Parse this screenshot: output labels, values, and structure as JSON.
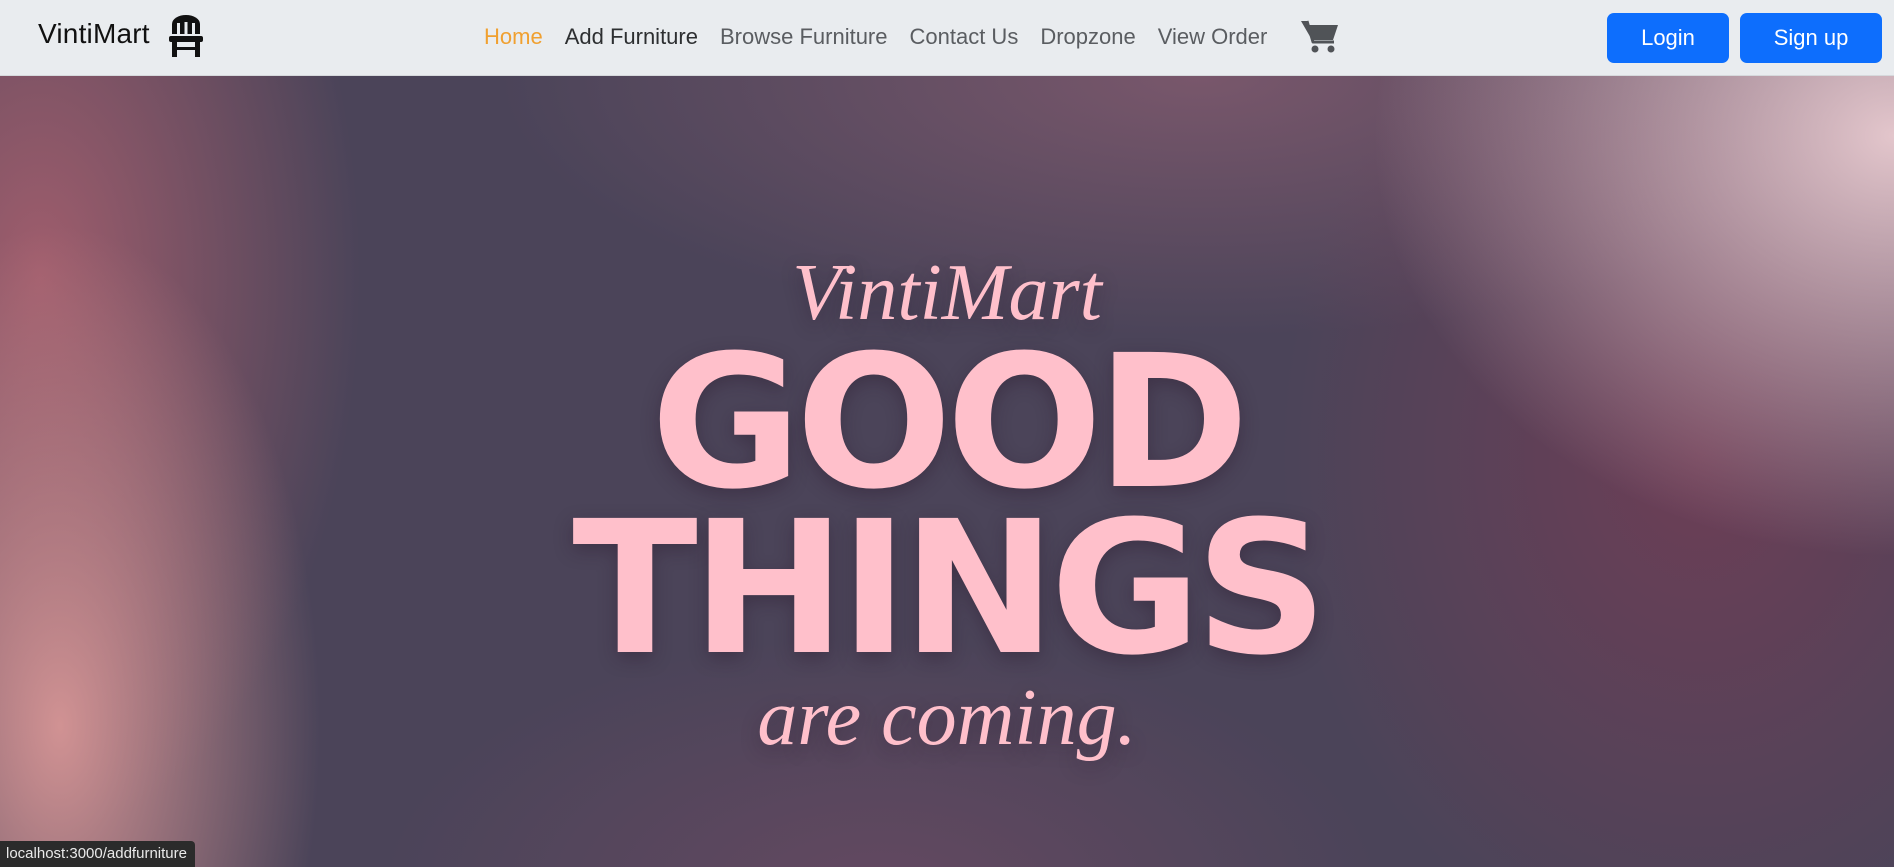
{
  "navbar": {
    "brand": "VintiMart",
    "brand_icon": "chair-icon",
    "links": [
      {
        "label": "Home",
        "state": "active"
      },
      {
        "label": "Add Furniture",
        "state": "hover"
      },
      {
        "label": "Browse Furniture",
        "state": "default"
      },
      {
        "label": "Contact Us",
        "state": "default"
      },
      {
        "label": "Dropzone",
        "state": "default"
      },
      {
        "label": "View Order",
        "state": "default"
      }
    ],
    "cart_icon": "cart-icon",
    "login_label": "Login",
    "signup_label": "Sign up"
  },
  "hero": {
    "top_line": "VintiMart",
    "line_1": "GOOD",
    "line_2": "THINGS",
    "bottom_line": "are coming."
  },
  "status_bar": {
    "url": "localhost:3000/addfurniture"
  },
  "colors": {
    "navbar_bg": "#e9ecef",
    "active_link": "#f0a030",
    "button_primary": "#0d6efd",
    "hero_text": "#ffc0cb"
  }
}
